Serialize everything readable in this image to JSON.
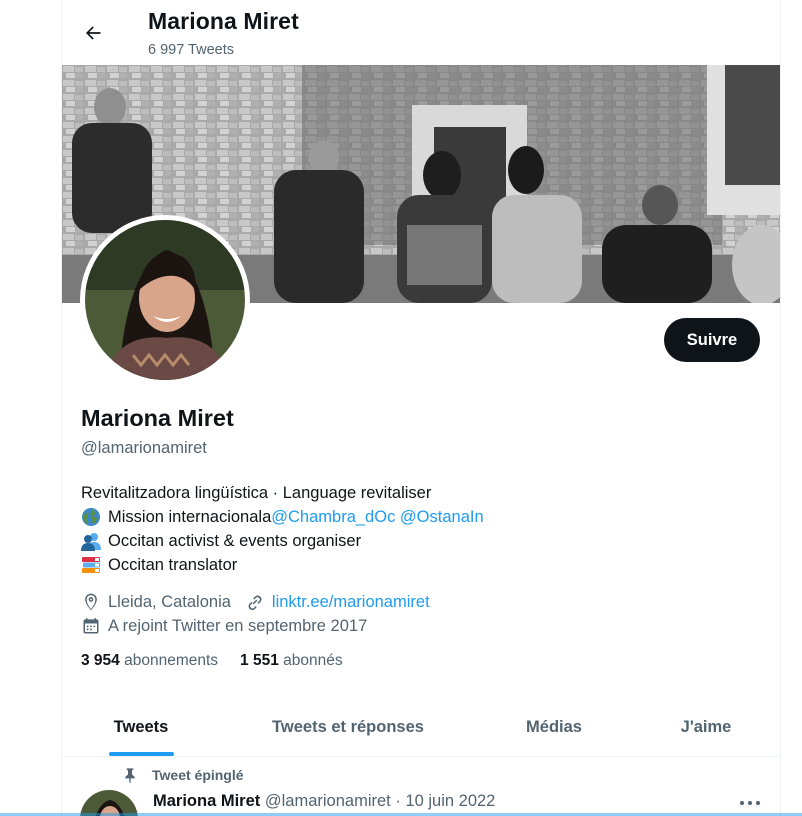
{
  "header": {
    "title": "Mariona Miret",
    "tweet_count": "6 997 Tweets"
  },
  "profile": {
    "follow_label": "Suivre",
    "name": "Mariona Miret",
    "handle": "@lamarionamiret",
    "bio": {
      "line1": "Revitalitzadora lingüística · Language revitaliser",
      "line2_text": "Mission internacionala ",
      "line2_mention1": "@Chambra_dOc",
      "line2_mention2": "@OstanaIn",
      "line3": "Occitan activist & events organiser",
      "line4": "Occitan translator"
    },
    "location": "Lleida, Catalonia",
    "website": "linktr.ee/marionamiret",
    "joined": "A rejoint Twitter en septembre 2017",
    "following_count": "3 954",
    "following_label": "abonnements",
    "followers_count": "1 551",
    "followers_label": "abonnés",
    "icons": [
      "back-arrow-icon",
      "globe-emoji",
      "people-emoji",
      "books-emoji",
      "location-pin-icon",
      "link-icon",
      "calendar-icon",
      "pushpin-icon",
      "more-dots-icon"
    ]
  },
  "tabs": [
    {
      "label": "Tweets",
      "active": true
    },
    {
      "label": "Tweets et réponses",
      "active": false
    },
    {
      "label": "Médias",
      "active": false
    },
    {
      "label": "J'aime",
      "active": false
    }
  ],
  "pinned_tweet": {
    "pinned_label": "Tweet épinglé",
    "author_name": "Mariona Miret",
    "author_handle": "@lamarionamiret",
    "separator": "·",
    "date": "10 juin 2022"
  },
  "colors": {
    "accent": "#1d9bf0",
    "text": "#0f1419",
    "secondary_text": "#536471",
    "follow_button": "#0f1419"
  }
}
